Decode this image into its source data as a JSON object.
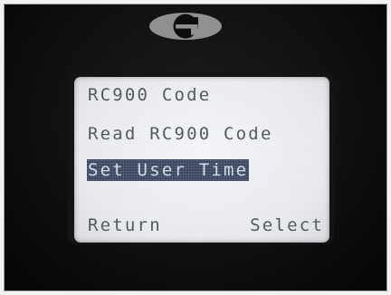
{
  "menu": {
    "items": [
      {
        "label": "RC900 Code"
      },
      {
        "label": "Read RC900 Code"
      },
      {
        "label": "Set User Time",
        "selected": true
      }
    ]
  },
  "softkeys": {
    "left": "Return",
    "right": "Select"
  },
  "colors": {
    "lcd_background": "#e6e8ec",
    "lcd_text": "#4b4f58",
    "highlight_background": "#3b4660",
    "highlight_text": "#d5dae6",
    "device_body": "#101010",
    "logo": "#9a9a9a"
  },
  "icons": {
    "brand_logo": "brand-logo-icon"
  }
}
